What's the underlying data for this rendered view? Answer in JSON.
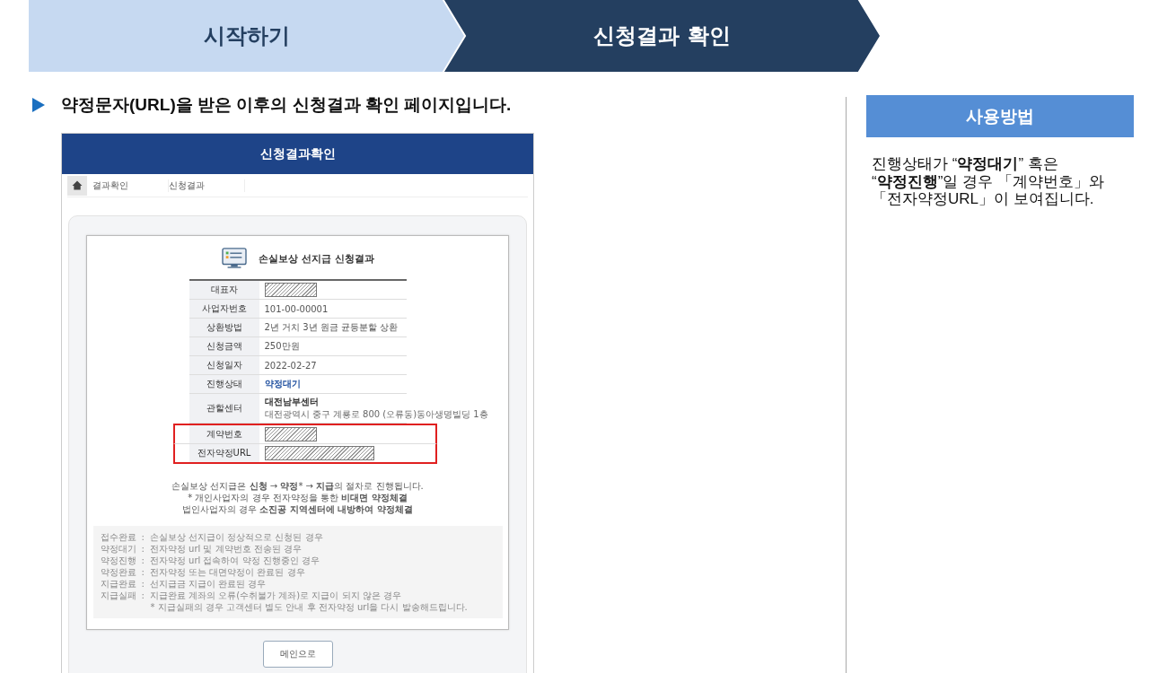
{
  "steps": [
    {
      "label": "시작하기",
      "selected": false
    },
    {
      "label": "신청결과 확인",
      "selected": true
    }
  ],
  "heading": "약정문자(URL)을 받은 이후의 신청결과 확인 페이지입니다.",
  "mock": {
    "title": "신청결과확인",
    "breadcrumb": [
      "결과확인",
      "신청결과"
    ],
    "result_title": "손실보상 선지급 신청결과",
    "rows": [
      {
        "label": "대표자",
        "kind": "redacted",
        "highlighted": false
      },
      {
        "label": "사업자번호",
        "kind": "text",
        "value": "101-00-00001",
        "highlighted": false
      },
      {
        "label": "상환방법",
        "kind": "text",
        "value": "2년 거치 3년 원금 균등분할 상환",
        "highlighted": false
      },
      {
        "label": "신청금액",
        "kind": "text",
        "value": "250만원",
        "highlighted": false
      },
      {
        "label": "신청일자",
        "kind": "text",
        "value": "2022-02-27",
        "highlighted": false
      },
      {
        "label": "진행상태",
        "kind": "status",
        "value": "약정대기",
        "highlighted": false
      },
      {
        "label": "관할센터",
        "kind": "center",
        "value": "대전남부센터",
        "address": "대전광역시 중구 계룡로 800 (오류동)동아생명빌딩 1층",
        "highlighted": false
      },
      {
        "label": "계약번호",
        "kind": "redacted",
        "highlighted": true
      },
      {
        "label": "전자약정URL",
        "kind": "redacted_long",
        "highlighted": true
      }
    ],
    "notes": [
      "손실보상 선지급은 **신청** → **약정*** → **지급**의 절차로 진행됩니다.",
      "* 개인사업자의 경우 전자약정을 통한 **비대면 약정체결**",
      "법인사업자의 경우 **소진공 지역센터에 내방하여 약정체결**"
    ],
    "legend": [
      {
        "term": "접수완료",
        "separator": ":",
        "desc": "손실보상 선지급이 정상적으로 신청된 경우"
      },
      {
        "term": "약정대기",
        "separator": ":",
        "desc": "전자약정 url 및 계약번호 전송된 경우"
      },
      {
        "term": "약정진행",
        "separator": ":",
        "desc": "전자약정 url 접속하여 약정 진행중인 경우"
      },
      {
        "term": "약정완료",
        "separator": ":",
        "desc": "전자약정 또는 대면약정이 완료된 경우"
      },
      {
        "term": "지급완료",
        "separator": ":",
        "desc": "선지급금 지급이 완료된 경우"
      },
      {
        "term": "지급실패",
        "separator": ":",
        "desc": "지급완료 계좌의 오류(수취불가 계좌)로 지급이 되지 않은 경우"
      }
    ],
    "legend_footnote": "* 지급실패의 경우 고객센터 별도 안내 후 전자약정 url을 다시 발송해드립니다.",
    "button": "메인으로"
  },
  "usage": {
    "title": "사용방법",
    "text": "진행상태가 “**약정대기**” 혹은 “**약정진행**”일 경우 「계약번호」와 「전자약정URL」이 보여집니다."
  }
}
